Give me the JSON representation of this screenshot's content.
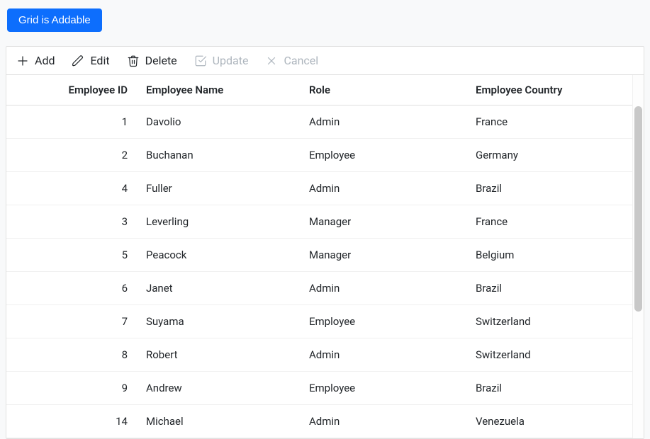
{
  "header": {
    "button_label": "Grid is Addable"
  },
  "toolbar": {
    "add_label": "Add",
    "edit_label": "Edit",
    "delete_label": "Delete",
    "update_label": "Update",
    "cancel_label": "Cancel"
  },
  "grid": {
    "columns": {
      "id": "Employee ID",
      "name": "Employee Name",
      "role": "Role",
      "country": "Employee Country"
    },
    "rows": [
      {
        "id": "1",
        "name": "Davolio",
        "role": "Admin",
        "country": "France"
      },
      {
        "id": "2",
        "name": "Buchanan",
        "role": "Employee",
        "country": "Germany"
      },
      {
        "id": "4",
        "name": "Fuller",
        "role": "Admin",
        "country": "Brazil"
      },
      {
        "id": "3",
        "name": "Leverling",
        "role": "Manager",
        "country": "France"
      },
      {
        "id": "5",
        "name": "Peacock",
        "role": "Manager",
        "country": "Belgium"
      },
      {
        "id": "6",
        "name": "Janet",
        "role": "Admin",
        "country": "Brazil"
      },
      {
        "id": "7",
        "name": "Suyama",
        "role": "Employee",
        "country": "Switzerland"
      },
      {
        "id": "8",
        "name": "Robert",
        "role": "Admin",
        "country": "Switzerland"
      },
      {
        "id": "9",
        "name": "Andrew",
        "role": "Employee",
        "country": "Brazil"
      },
      {
        "id": "14",
        "name": "Michael",
        "role": "Admin",
        "country": "Venezuela"
      }
    ]
  }
}
